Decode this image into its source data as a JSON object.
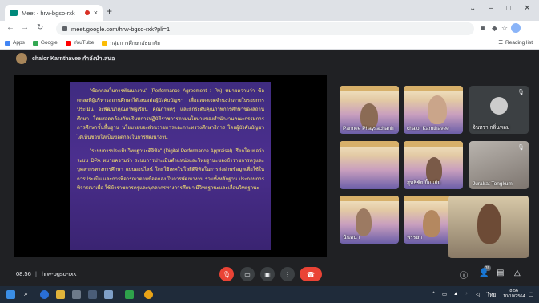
{
  "browser": {
    "tab_title": "Meet - hrw-bgso-rxk",
    "tab_close": "×",
    "new_tab": "+",
    "url": "meet.google.com/hrw-bgso-rxk?pli=1",
    "window_controls": [
      "⌄",
      "–",
      "□",
      "✕"
    ]
  },
  "bookmarks": [
    {
      "label": "Apps",
      "color": "#4285f4"
    },
    {
      "label": "Google",
      "color": "#34a853"
    },
    {
      "label": "YouTube",
      "color": "#ff0000"
    },
    {
      "label": "กลุ่มการศึกษาอัธยาศัย",
      "color": "#fbbc05"
    }
  ],
  "reading_list": "Reading list",
  "meet": {
    "presenter": "chalor Karnthavee กำลังนำเสนอ",
    "slide_paragraphs": [
      "\"ข้อตกลงในการพัฒนางาน\" (Performance Agreement : PA) หมายความว่า ข้อตกลงที่ผู้บริหารสถานศึกษาได้เสนอต่อผู้บังคับบัญชา เพื่อแสดงเจตจำนงว่าภายในรอบการประเมิน จะพัฒนาคุณภาพผู้เรียน คุณภาพครู และยกระดับคุณภาพการศึกษาของสถานศึกษา โดยสอดคล้องกับบริบทการปฏิบัติราชการตามนโยบายของสำนักงานคณะกรรมการการศึกษาขั้นพื้นฐาน นโยบายของส่วนราชการและกระทรวงศึกษาธิการ โดยผู้บังคับบัญชาได้เห็นชอบให้เป็นข้อตกลงในการพัฒนางาน",
      "\"ระบบการประเมินวิทยฐานะดิจิทัล\" (Digital Performance Appraisal) เรียกโดยย่อว่า ระบบ DPA หมายความว่า ระบบการประเมินตำแหน่งและวิทยฐานะของข้าราชการครูและบุคลากรทางการศึกษา แบบออนไลน์ โดยใช้เทคโนโลยีดิจิทัลในการส่งผ่านข้อมูลเพื่อใช้ในการประเมิน และการพิจารณาตามข้อตกลง ในการพัฒนางาน รวมทั้งหลักฐาน ประกอบการพิจารณาเพื่อ ใช้ข้าราชการครูและบุคลากรทางการศึกษา มีวิทยฐานะและเลื่อนวิทยฐานะ"
    ],
    "tiles": [
      {
        "name": "Pannee Phaysachanh",
        "kind": "slide"
      },
      {
        "name": "chalor Karnthavee",
        "kind": "slide"
      },
      {
        "name": "จินทรา กลิ่นหอม",
        "kind": "avatar"
      },
      {
        "name": "",
        "kind": "slide"
      },
      {
        "name": "สุทธิชัย ยิ้มแย้ม",
        "kind": "slide"
      },
      {
        "name": "Juralrat Tongkum",
        "kind": "dark"
      },
      {
        "name": "นันทนา",
        "kind": "slide"
      },
      {
        "name": "พรรษา",
        "kind": "slide"
      },
      {
        "name": "",
        "kind": "self"
      }
    ],
    "time": "08:56",
    "separator": "|",
    "meeting_code": "hrw-bgso-rxk",
    "participant_count": "76"
  },
  "taskbar": {
    "lang": "ไทย",
    "clock_time": "8:56",
    "clock_date": "10/10/2564"
  },
  "colors": {
    "slide_bg": "#4b2f8e",
    "slide_text": "#ffeb70",
    "hangup": "#ea4335"
  }
}
